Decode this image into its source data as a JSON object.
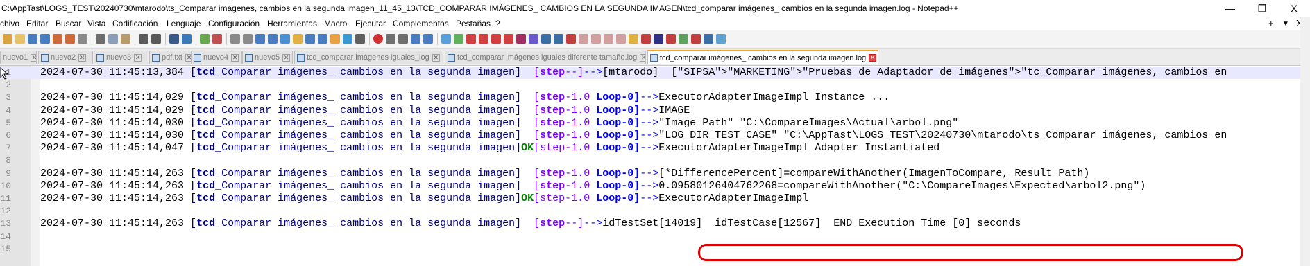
{
  "window": {
    "title": "C:\\AppTast\\LOGS_TEST\\20240730\\mtarodo\\ts_Comparar imágenes, cambios en la segunda imagen_11_45_13\\TCD_COMPARAR IMÁGENES_ CAMBIOS EN LA SEGUNDA IMAGEN\\tcd_comparar imágenes_ cambios en la segunda imagen.log - Notepad++",
    "minimize": "—",
    "restore": "❐",
    "close": "X"
  },
  "menu": {
    "items": [
      "chivo",
      "Editar",
      "Buscar",
      "Vista",
      "Codificación",
      "Lenguaje",
      "Configuración",
      "Herramientas",
      "Macro",
      "Ejecutar",
      "Complementos",
      "Pestañas",
      "?"
    ],
    "right_plus": "+",
    "right_dropdown": "▼",
    "right_close": "X"
  },
  "tabs": [
    {
      "label": "nuevo1"
    },
    {
      "label": "nuevo2"
    },
    {
      "label": "nuevo3"
    },
    {
      "label": "pdf.txt"
    },
    {
      "label": "nuevo4"
    },
    {
      "label": "nuevo5"
    },
    {
      "label": "tcd_comparar imágenes iguales_log"
    },
    {
      "label": "tcd_comparar imágenes iguales diferente tamaño.log"
    },
    {
      "label": "tcd_comparar imágenes_ cambios en la segunda imagen.log"
    }
  ],
  "lines": [
    {
      "n": "1",
      "parts": [
        [
          "",
          "2024-07-30 11:45:13,384 "
        ],
        [
          "k-tcdn",
          "["
        ],
        [
          "k-tcd",
          "tcd"
        ],
        [
          "k-tcdn",
          "_Comparar imágenes_ cambios en la segunda imagen]  "
        ],
        [
          "k-stepn",
          "["
        ],
        [
          "k-step",
          "step"
        ],
        [
          "k-stepn",
          "--]"
        ],
        [
          "k-arrow",
          "-->"
        ],
        [
          "",
          "[mtarodo]  [\"SIPSA\">\"MARKETING\">\"Pruebas de Adaptador de imágenes\">\"tc_Comparar imágenes, cambios en"
        ]
      ]
    },
    {
      "n": "2",
      "parts": [
        [
          "",
          ""
        ]
      ]
    },
    {
      "n": "3",
      "parts": [
        [
          "",
          "2024-07-30 11:45:14,029 "
        ],
        [
          "k-tcdn",
          "["
        ],
        [
          "k-tcd",
          "tcd"
        ],
        [
          "k-tcdn",
          "_Comparar imágenes_ cambios en la segunda imagen]  "
        ],
        [
          "k-stepn",
          "["
        ],
        [
          "k-step",
          "step"
        ],
        [
          "k-stepn",
          "-1.0 "
        ],
        [
          "k-loop",
          "Loop-0]"
        ],
        [
          "k-arrow",
          "-->"
        ],
        [
          "",
          "ExecutorAdapterImageImpl Instance ..."
        ]
      ]
    },
    {
      "n": "4",
      "parts": [
        [
          "",
          "2024-07-30 11:45:14,029 "
        ],
        [
          "k-tcdn",
          "["
        ],
        [
          "k-tcd",
          "tcd"
        ],
        [
          "k-tcdn",
          "_Comparar imágenes_ cambios en la segunda imagen]  "
        ],
        [
          "k-stepn",
          "["
        ],
        [
          "k-step",
          "step"
        ],
        [
          "k-stepn",
          "-1.0 "
        ],
        [
          "k-loop",
          "Loop-0]"
        ],
        [
          "k-arrow",
          "-->"
        ],
        [
          "",
          "IMAGE"
        ]
      ]
    },
    {
      "n": "5",
      "parts": [
        [
          "",
          "2024-07-30 11:45:14,030 "
        ],
        [
          "k-tcdn",
          "["
        ],
        [
          "k-tcd",
          "tcd"
        ],
        [
          "k-tcdn",
          "_Comparar imágenes_ cambios en la segunda imagen]  "
        ],
        [
          "k-stepn",
          "["
        ],
        [
          "k-step",
          "step"
        ],
        [
          "k-stepn",
          "-1.0 "
        ],
        [
          "k-loop",
          "Loop-0]"
        ],
        [
          "k-arrow",
          "-->"
        ],
        [
          "",
          "\"Image Path\" \"C:\\CompareImages\\Actual\\arbol.png\""
        ]
      ]
    },
    {
      "n": "6",
      "parts": [
        [
          "",
          "2024-07-30 11:45:14,030 "
        ],
        [
          "k-tcdn",
          "["
        ],
        [
          "k-tcd",
          "tcd"
        ],
        [
          "k-tcdn",
          "_Comparar imágenes_ cambios en la segunda imagen]  "
        ],
        [
          "k-stepn",
          "["
        ],
        [
          "k-step",
          "step"
        ],
        [
          "k-stepn",
          "-1.0 "
        ],
        [
          "k-loop",
          "Loop-0]"
        ],
        [
          "k-arrow",
          "-->"
        ],
        [
          "",
          "\"LOG_DIR_TEST_CASE\" \"C:\\AppTast\\LOGS_TEST\\20240730\\mtarodo\\ts_Comparar imágenes, cambios en"
        ]
      ]
    },
    {
      "n": "7",
      "parts": [
        [
          "",
          "2024-07-30 11:45:14,047 "
        ],
        [
          "k-tcdn",
          "["
        ],
        [
          "k-tcd",
          "tcd"
        ],
        [
          "k-tcdn",
          "_Comparar imágenes_ cambios en la segunda imagen]"
        ],
        [
          "k-ok",
          "OK"
        ],
        [
          "k-stepn",
          "["
        ],
        [
          "k-stepn",
          "step-1.0 "
        ],
        [
          "k-loop",
          "Loop-0]"
        ],
        [
          "k-arrow",
          "-->"
        ],
        [
          "",
          "ExecutorAdapterImageImpl Adapter Instantiated"
        ]
      ]
    },
    {
      "n": "8",
      "parts": [
        [
          "",
          ""
        ]
      ]
    },
    {
      "n": "9",
      "parts": [
        [
          "",
          "2024-07-30 11:45:14,263 "
        ],
        [
          "k-tcdn",
          "["
        ],
        [
          "k-tcd",
          "tcd"
        ],
        [
          "k-tcdn",
          "_Comparar imágenes_ cambios en la segunda imagen]  "
        ],
        [
          "k-stepn",
          "["
        ],
        [
          "k-step",
          "step"
        ],
        [
          "k-stepn",
          "-1.0 "
        ],
        [
          "k-loop",
          "Loop-0]"
        ],
        [
          "k-arrow",
          "-->"
        ],
        [
          "",
          "[*DifferencePercent]=compareWithAnother(ImagenToCompare, Result Path)"
        ]
      ]
    },
    {
      "n": "10",
      "parts": [
        [
          "",
          "2024-07-30 11:45:14,263 "
        ],
        [
          "k-tcdn",
          "["
        ],
        [
          "k-tcd",
          "tcd"
        ],
        [
          "k-tcdn",
          "_Comparar imágenes_ cambios en la segunda imagen]  "
        ],
        [
          "k-stepn",
          "["
        ],
        [
          "k-step",
          "step"
        ],
        [
          "k-stepn",
          "-1.0 "
        ],
        [
          "k-loop",
          "Loop-0]"
        ],
        [
          "k-arrow",
          "-->"
        ],
        [
          "",
          "0.09580126404762268=compareWithAnother(\"C:\\CompareImages\\Expected\\arbol2.png\")"
        ]
      ]
    },
    {
      "n": "11",
      "parts": [
        [
          "",
          "2024-07-30 11:45:14,263 "
        ],
        [
          "k-tcdn",
          "["
        ],
        [
          "k-tcd",
          "tcd"
        ],
        [
          "k-tcdn",
          "_Comparar imágenes_ cambios en la segunda imagen]"
        ],
        [
          "k-ok",
          "OK"
        ],
        [
          "k-stepn",
          "[step-1.0 "
        ],
        [
          "k-loop",
          "Loop-0]"
        ],
        [
          "k-arrow",
          "-->"
        ],
        [
          "",
          "ExecutorAdapterImageImpl"
        ]
      ]
    },
    {
      "n": "12",
      "parts": [
        [
          "",
          ""
        ]
      ]
    },
    {
      "n": "13",
      "parts": [
        [
          "",
          "2024-07-30 11:45:14,263 "
        ],
        [
          "k-tcdn",
          "["
        ],
        [
          "k-tcd",
          "tcd"
        ],
        [
          "k-tcdn",
          "_Comparar imágenes_ cambios en la segunda imagen]  "
        ],
        [
          "k-stepn",
          "["
        ],
        [
          "k-step",
          "step"
        ],
        [
          "k-stepn",
          "--]"
        ],
        [
          "k-arrow",
          "-->"
        ],
        [
          "",
          "idTestSet[14019]  idTestCase[12567]  END Execution Time [0] seconds"
        ]
      ]
    },
    {
      "n": "14",
      "parts": [
        [
          "",
          ""
        ]
      ]
    },
    {
      "n": "15",
      "parts": [
        [
          "",
          ""
        ]
      ]
    }
  ],
  "colors": {
    "highlight_box": "#e00000",
    "active_tab_accent": "#f5a623",
    "current_line": "#e8e8ff"
  }
}
